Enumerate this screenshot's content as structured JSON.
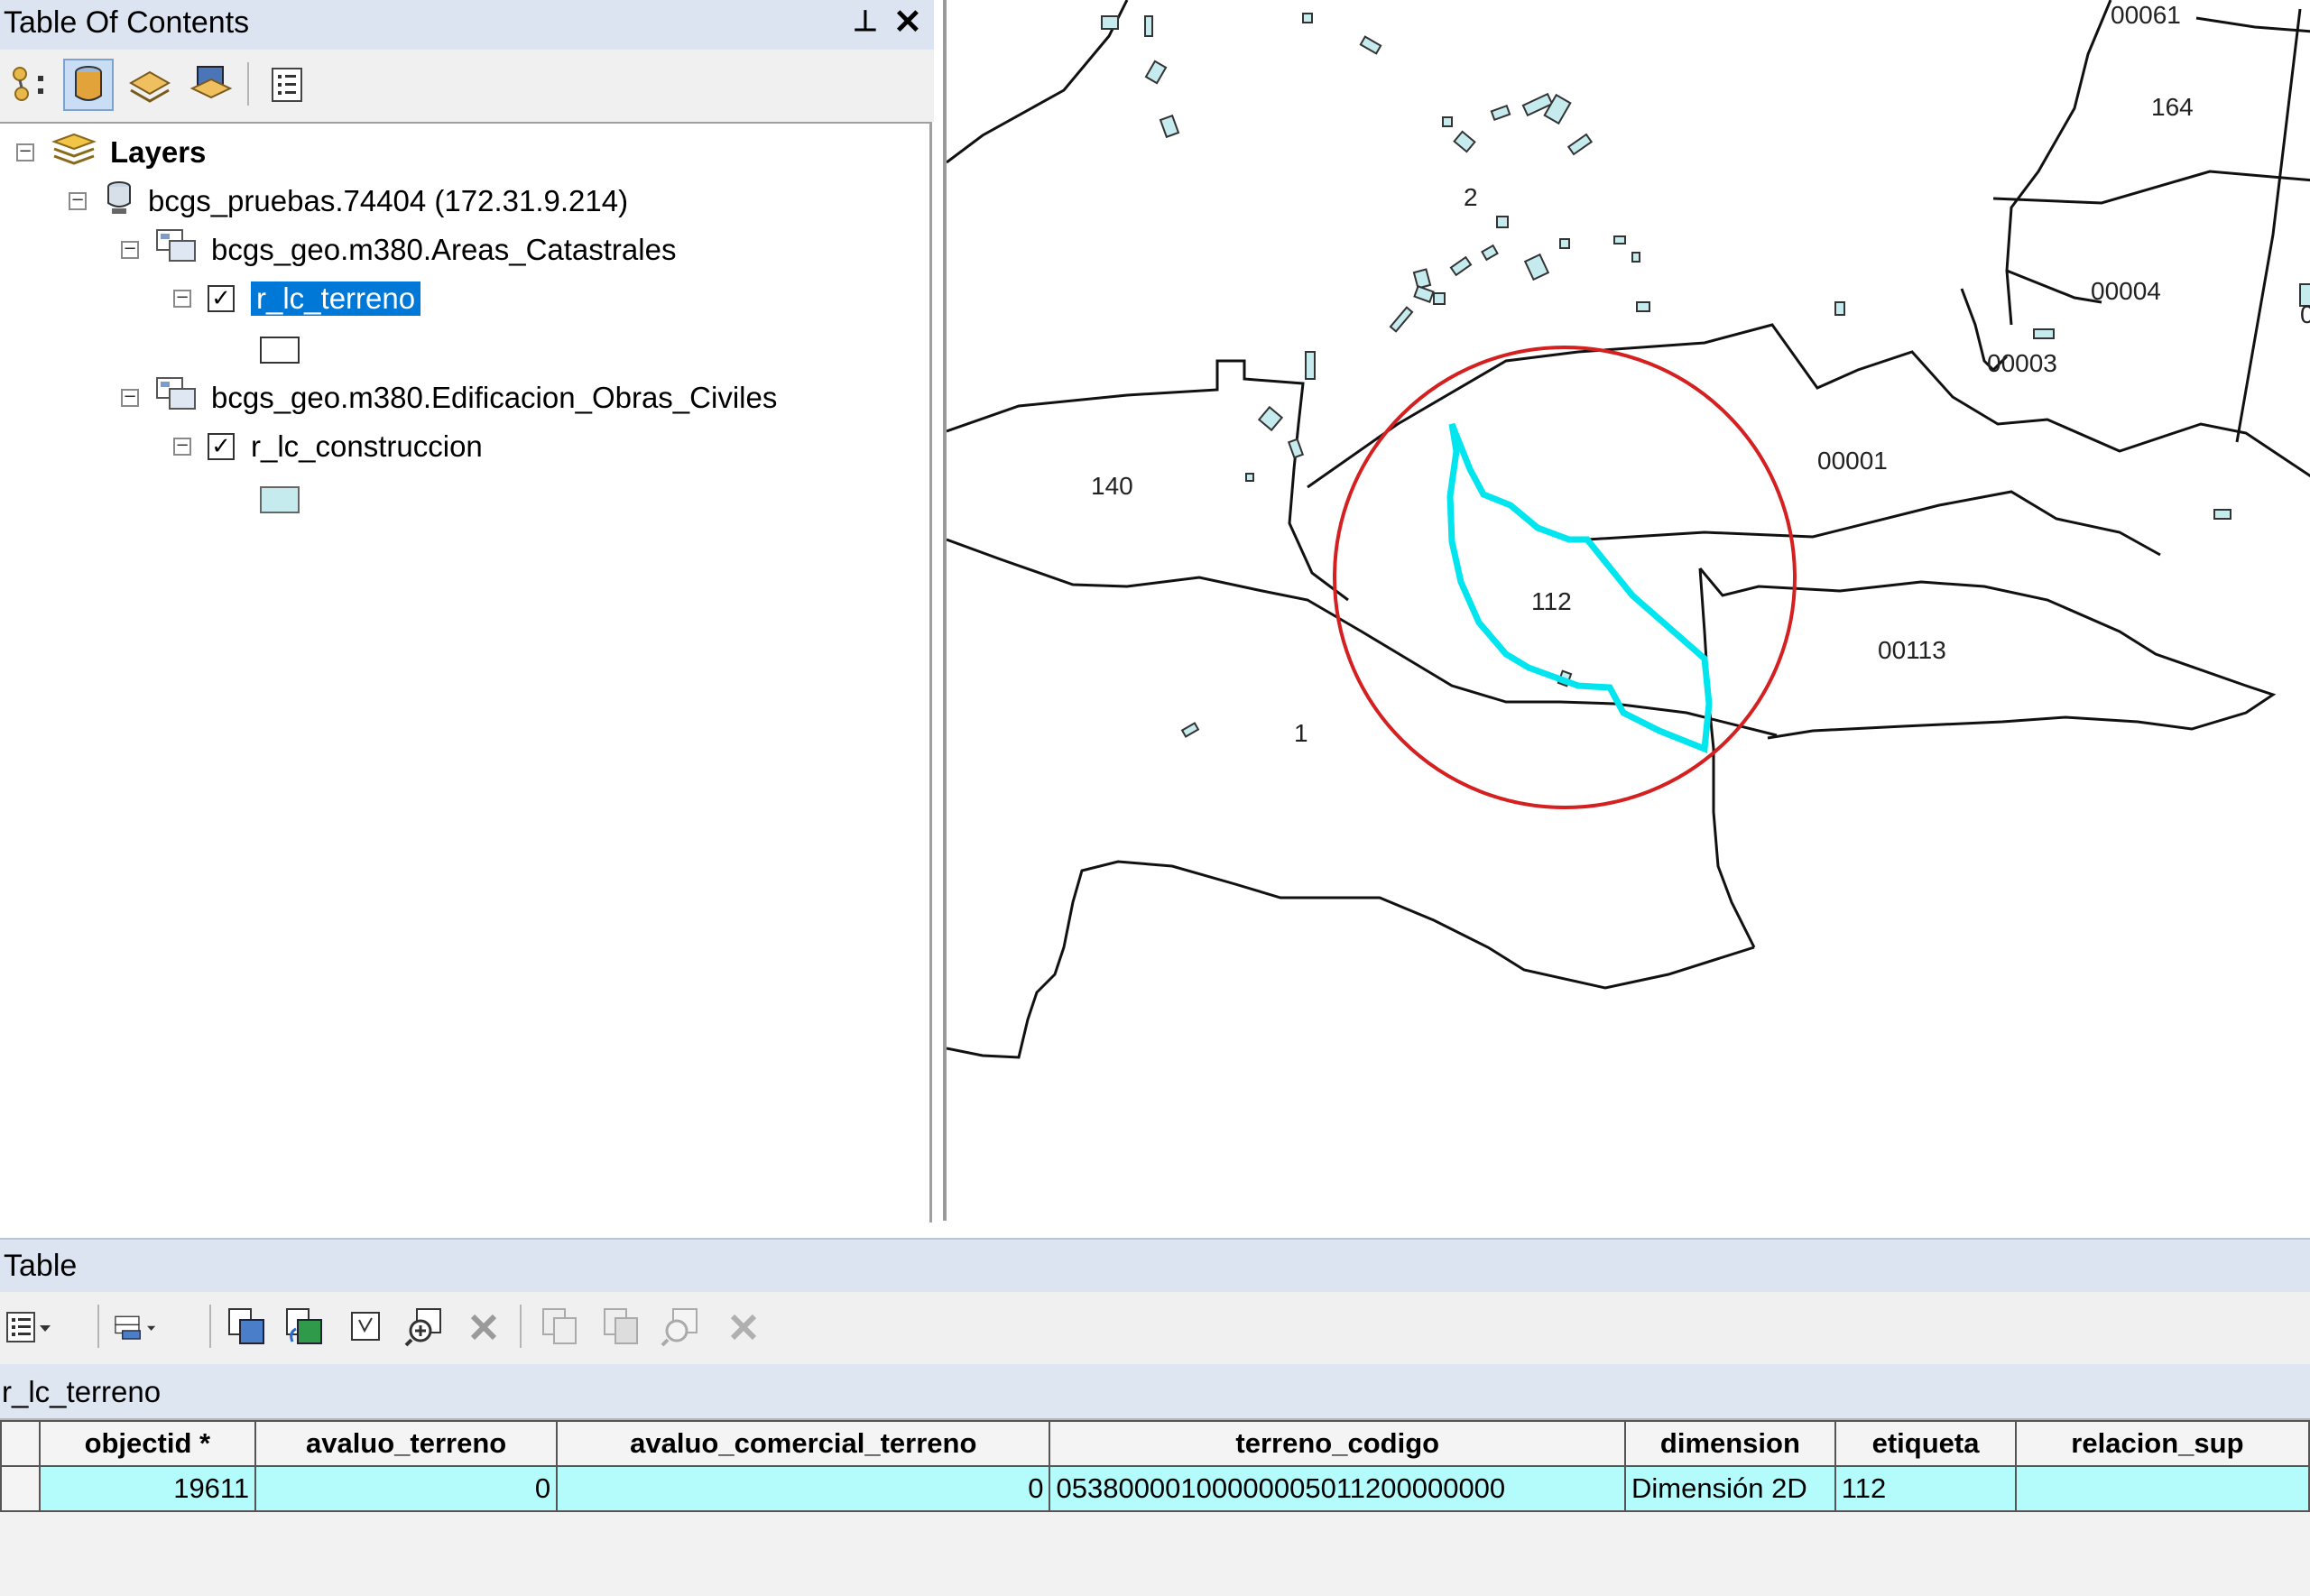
{
  "toc": {
    "title": "Table Of Contents",
    "pin_icon": "pin-icon",
    "close_icon": "close-icon",
    "tree": {
      "root": "Layers",
      "database": "bcgs_pruebas.74404 (172.31.9.214)",
      "group1": "bcgs_geo.m380.Areas_Catastrales",
      "layer1": "r_lc_terreno",
      "group2": "bcgs_geo.m380.Edificacion_Obras_Civiles",
      "layer2": "r_lc_construccion"
    }
  },
  "map": {
    "labels": {
      "l00061": "00061",
      "l164": "164",
      "l2": "2",
      "l00004": "00004",
      "l00003": "00003",
      "l00001": "00001",
      "l140": "140",
      "l112": "112",
      "l00113": "00113",
      "l1": "1",
      "l0_edge": "0"
    },
    "highlight_color": "#00e5ee",
    "annotation_circle_color": "#d42020"
  },
  "table": {
    "title": "Table",
    "layer_tab": "r_lc_terreno",
    "columns": [
      "objectid *",
      "avaluo_terreno",
      "avaluo_comercial_terreno",
      "terreno_codigo",
      "dimension",
      "etiqueta",
      "relacion_sup"
    ],
    "row": {
      "objectid": "19611",
      "avaluo_terreno": "0",
      "avaluo_comercial_terreno": "0",
      "terreno_codigo": "05380000100000005011200000000",
      "dimension": "Dimensión 2D",
      "etiqueta": "112",
      "relacion_sup": ""
    },
    "selected_row_color": "#b4fbfb"
  }
}
